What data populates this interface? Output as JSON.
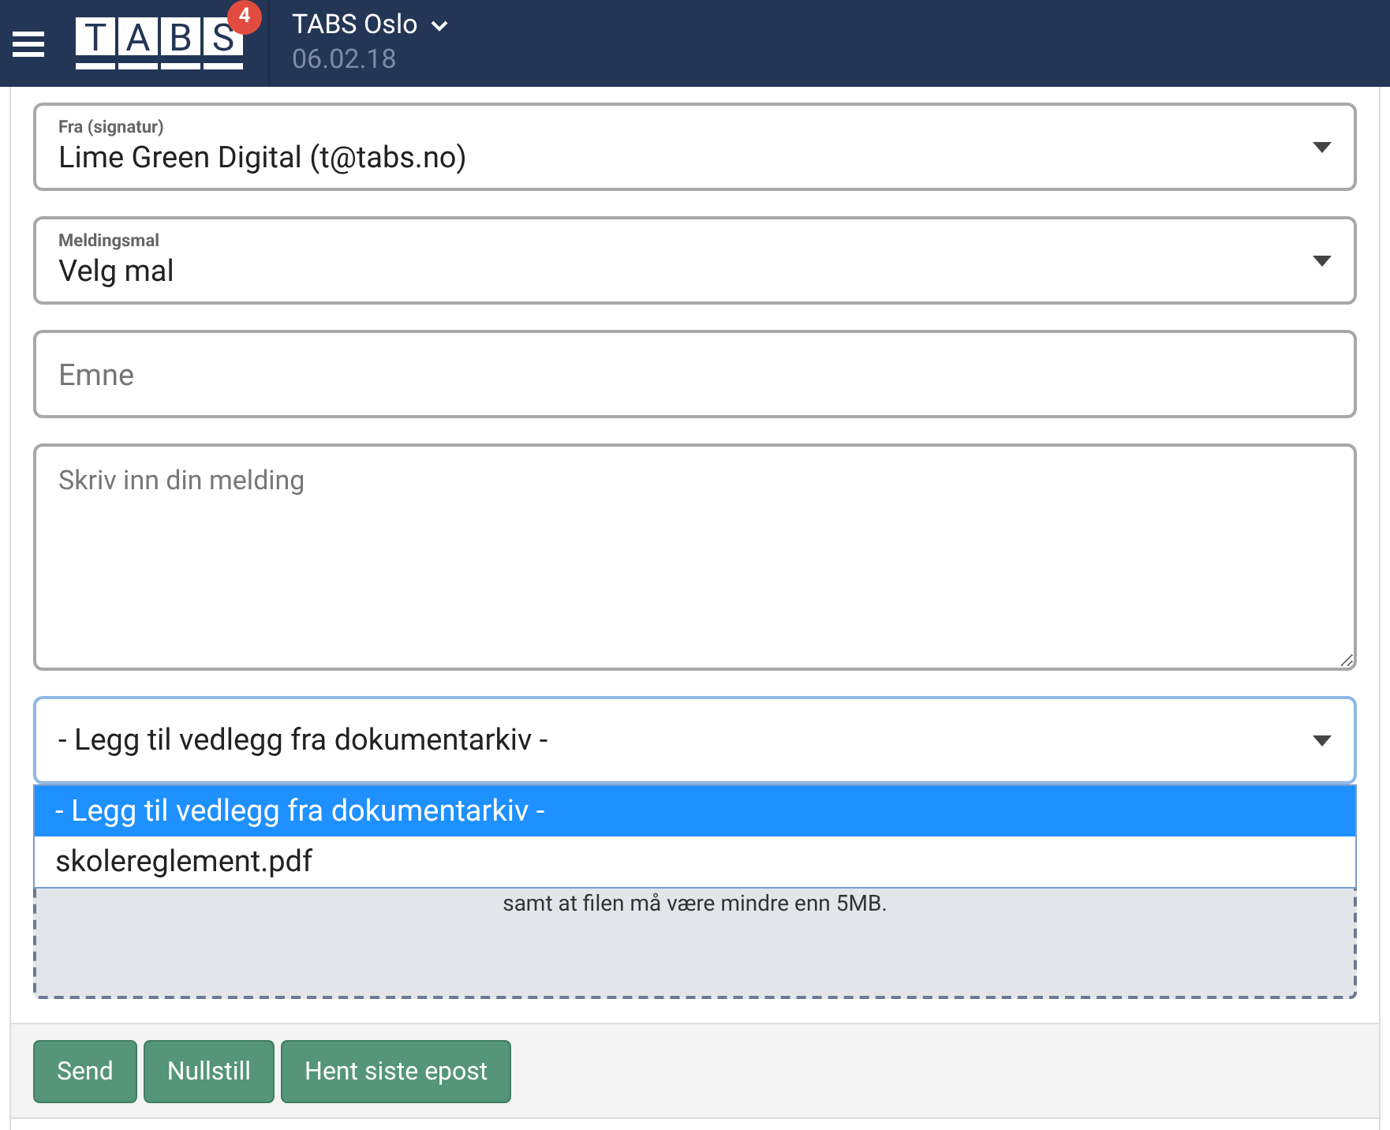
{
  "header": {
    "logo_letters": [
      "T",
      "A",
      "B",
      "S"
    ],
    "badge": "4",
    "school": "TABS Oslo",
    "date": "06.02.18"
  },
  "form": {
    "from": {
      "label": "Fra (signatur)",
      "value": "Lime Green Digital (t@tabs.no)"
    },
    "template": {
      "label": "Meldingsmal",
      "value": "Velg mal"
    },
    "subject": {
      "placeholder": "Emne"
    },
    "message": {
      "placeholder": "Skriv inn din melding"
    },
    "attachment": {
      "value": "- Legg til vedlegg fra dokumentarkiv -",
      "expanded": true,
      "options": [
        {
          "label": "- Legg til vedlegg fra dokumentarkiv -",
          "selected": true
        },
        {
          "label": "skolereglement.pdf",
          "selected": false
        }
      ]
    },
    "dropzone": {
      "text": "samt at filen må være mindre enn 5MB."
    }
  },
  "buttons": [
    "Send",
    "Nullstill",
    "Hent siste epost"
  ]
}
